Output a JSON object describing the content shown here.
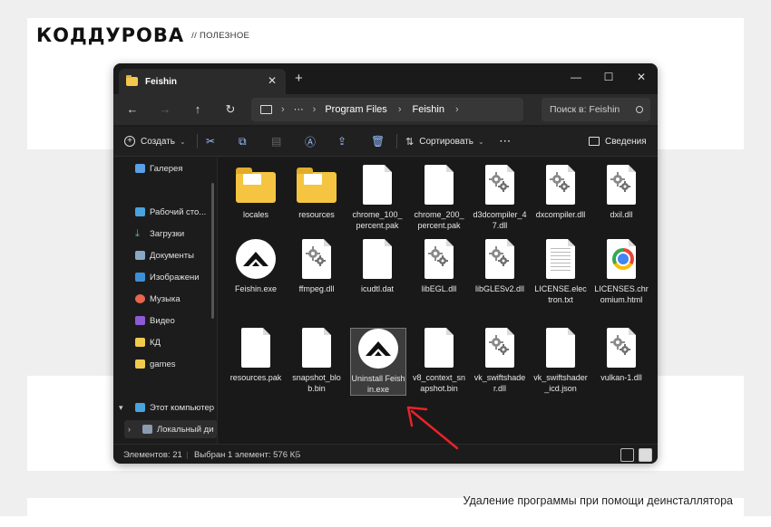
{
  "brand": {
    "logo": "КОДДУРОВА",
    "section": "// ПОЛЕЗНОЕ"
  },
  "caption": "Удаление программы при помощи деинсталлятора",
  "window": {
    "tab_title": "Feishin",
    "tab_close": "✕",
    "new_tab": "+",
    "controls": {
      "minimize": "—",
      "maximize": "☐",
      "close": "✕"
    }
  },
  "address_bar": {
    "back": "←",
    "forward": "→",
    "up": "↑",
    "refresh": "↻",
    "path": [
      "Program Files",
      "Feishin"
    ],
    "ellipsis": "···",
    "search_placeholder": "Поиск в: Feishin"
  },
  "command_bar": {
    "create": "Создать",
    "sort": "Сортировать",
    "more": "···",
    "details": "Сведения"
  },
  "sidebar": {
    "items": [
      {
        "label": "Галерея",
        "icon": "gallery-icon",
        "pinned": false
      },
      {
        "label": "Рабочий сто...",
        "icon": "desktop-icon",
        "pinned": true
      },
      {
        "label": "Загрузки",
        "icon": "download-icon",
        "pinned": true
      },
      {
        "label": "Документы",
        "icon": "documents-icon",
        "pinned": true
      },
      {
        "label": "Изображени",
        "icon": "pictures-icon",
        "pinned": true
      },
      {
        "label": "Музыка",
        "icon": "music-icon",
        "pinned": true
      },
      {
        "label": "Видео",
        "icon": "video-icon",
        "pinned": true
      },
      {
        "label": "КД",
        "icon": "folder-icon",
        "pinned": true
      },
      {
        "label": "games",
        "icon": "folder-icon",
        "pinned": false
      },
      {
        "label": "Этот компьютер",
        "icon": "computer-icon",
        "pinned": false
      },
      {
        "label": "Локальный ди",
        "icon": "drive-icon",
        "pinned": false
      }
    ],
    "pin_glyph": "📌"
  },
  "files": [
    {
      "name": "locales",
      "type": "folder"
    },
    {
      "name": "resources",
      "type": "folder"
    },
    {
      "name": "chrome_100_percent.pak",
      "type": "doc"
    },
    {
      "name": "chrome_200_percent.pak",
      "type": "doc"
    },
    {
      "name": "d3dcompiler_47.dll",
      "type": "dll"
    },
    {
      "name": "dxcompiler.dll",
      "type": "dll"
    },
    {
      "name": "dxil.dll",
      "type": "dll"
    },
    {
      "name": "Feishin.exe",
      "type": "app"
    },
    {
      "name": "ffmpeg.dll",
      "type": "dll"
    },
    {
      "name": "icudtl.dat",
      "type": "doc"
    },
    {
      "name": "libEGL.dll",
      "type": "dll"
    },
    {
      "name": "libGLESv2.dll",
      "type": "dll"
    },
    {
      "name": "LICENSE.electron.txt",
      "type": "txt"
    },
    {
      "name": "LICENSES.chromium.html",
      "type": "chrome"
    },
    {
      "name": "resources.pak",
      "type": "doc"
    },
    {
      "name": "snapshot_blob.bin",
      "type": "doc"
    },
    {
      "name": "Uninstall Feishin.exe",
      "type": "app",
      "selected": true
    },
    {
      "name": "v8_context_snapshot.bin",
      "type": "doc"
    },
    {
      "name": "vk_swiftshader.dll",
      "type": "dll"
    },
    {
      "name": "vk_swiftshader_icd.json",
      "type": "doc"
    },
    {
      "name": "vulkan-1.dll",
      "type": "dll"
    }
  ],
  "status_bar": {
    "count": "Элементов: 21",
    "selection": "Выбран 1 элемент: 576 КБ"
  },
  "colors": {
    "annotation_arrow": "#e8232a",
    "window_bg": "#1c1c1c",
    "folder": "#f5c542"
  }
}
